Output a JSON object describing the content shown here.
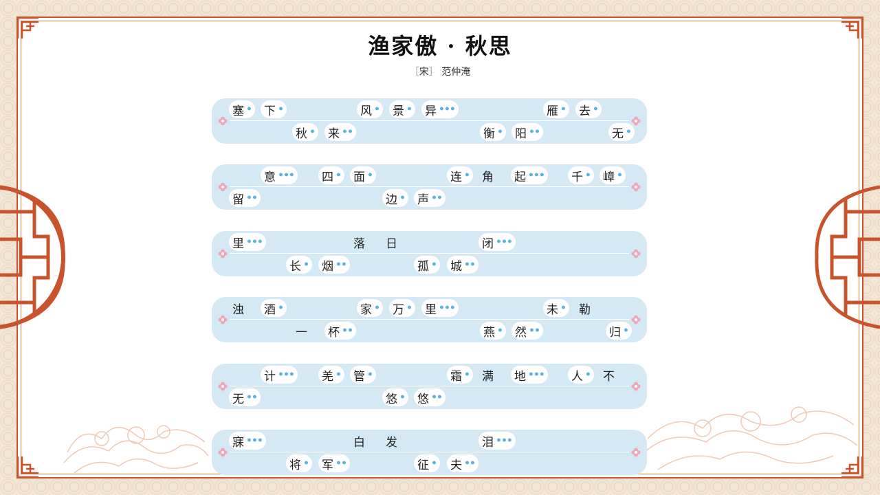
{
  "poem": {
    "title": "渔家傲 · 秋思",
    "dynasty": "宋",
    "author": "范仲淹"
  },
  "lines": [
    {
      "top": [
        [
          "塞",
          1
        ],
        [
          "下",
          1
        ],
        [
          "风",
          1
        ],
        [
          "景",
          1
        ],
        [
          "异",
          3
        ],
        [
          "雁",
          1
        ],
        [
          "去",
          1
        ]
      ],
      "bottom": [
        [
          "秋",
          1
        ],
        [
          "来",
          2
        ],
        [
          "衡",
          1
        ],
        [
          "阳",
          2
        ],
        [
          "无",
          1
        ]
      ]
    },
    {
      "top": [
        [
          "意",
          3
        ],
        [
          "四",
          1
        ],
        [
          "面",
          1
        ],
        [
          "连",
          1
        ],
        [
          "角",
          0
        ],
        [
          "起",
          3
        ],
        [
          "千",
          1
        ],
        [
          "嶂",
          1
        ]
      ],
      "bottom": [
        [
          "留",
          2
        ],
        [
          "边",
          1
        ],
        [
          "声",
          2
        ]
      ]
    },
    {
      "top": [
        [
          "里",
          3
        ],
        [
          "落",
          0
        ],
        [
          "日",
          0
        ],
        [
          "闭",
          3
        ]
      ],
      "bottom": [
        [
          "长",
          1
        ],
        [
          "烟",
          2
        ],
        [
          "孤",
          1
        ],
        [
          "城",
          2
        ]
      ]
    },
    {
      "top": [
        [
          "浊",
          0
        ],
        [
          "酒",
          1
        ],
        [
          "家",
          1
        ],
        [
          "万",
          1
        ],
        [
          "里",
          3
        ],
        [
          "未",
          1
        ],
        [
          "勒",
          0
        ]
      ],
      "bottom": [
        [
          "一",
          0
        ],
        [
          "杯",
          2
        ],
        [
          "燕",
          1
        ],
        [
          "然",
          2
        ],
        [
          "归",
          1
        ]
      ]
    },
    {
      "top": [
        [
          "计",
          3
        ],
        [
          "羌",
          1
        ],
        [
          "管",
          1
        ],
        [
          "霜",
          1
        ],
        [
          "满",
          0
        ],
        [
          "地",
          3
        ],
        [
          "人",
          1
        ],
        [
          "不",
          0
        ]
      ],
      "bottom": [
        [
          "无",
          2
        ],
        [
          "悠",
          1
        ],
        [
          "悠",
          2
        ]
      ]
    },
    {
      "top": [
        [
          "寐",
          3
        ],
        [
          "白",
          0
        ],
        [
          "发",
          0
        ],
        [
          "泪",
          3
        ]
      ],
      "bottom": [
        [
          "将",
          1
        ],
        [
          "军",
          2
        ],
        [
          "征",
          1
        ],
        [
          "夫",
          2
        ]
      ]
    }
  ],
  "colors": {
    "accent": "#c9532c",
    "row_bg": "#d5e9f4",
    "tone_dot": "#5ab3e0",
    "flower": "#f0a8b8"
  }
}
